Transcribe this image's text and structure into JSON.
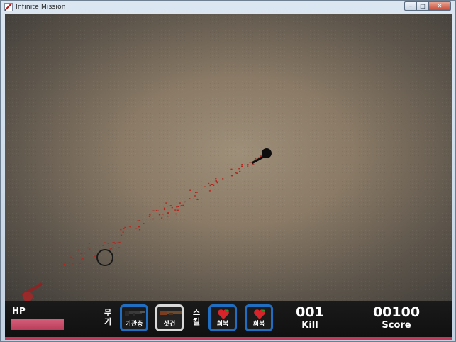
{
  "window": {
    "title": "Infinite Mission",
    "controls": {
      "minimize": "–",
      "maximize": "□",
      "close": "✕"
    }
  },
  "hud": {
    "hp_label": "HP",
    "hp_fraction": 1.0,
    "weapon_label_lines": [
      "무",
      "기"
    ],
    "skill_label_lines": [
      "스",
      "킬"
    ],
    "weapons": [
      {
        "label": "기관총",
        "icon": "machine-gun-icon",
        "selected": false
      },
      {
        "label": "샷건",
        "icon": "shotgun-icon",
        "selected": true
      }
    ],
    "skills": [
      {
        "label": "회복",
        "icon": "heart-heal-icon"
      },
      {
        "label": "회복",
        "icon": "heart-heal-icon"
      }
    ],
    "kill": {
      "value": "001",
      "label": "Kill"
    },
    "score": {
      "value": "00100",
      "label": "Score"
    }
  },
  "colors": {
    "hp": "#c94e6b",
    "slot_border": "#1f6ec2",
    "selected_border": "#d9d9d9",
    "heart": "#d8232a",
    "leaf": "#2e8b2e",
    "bullet": "#b3261e"
  }
}
